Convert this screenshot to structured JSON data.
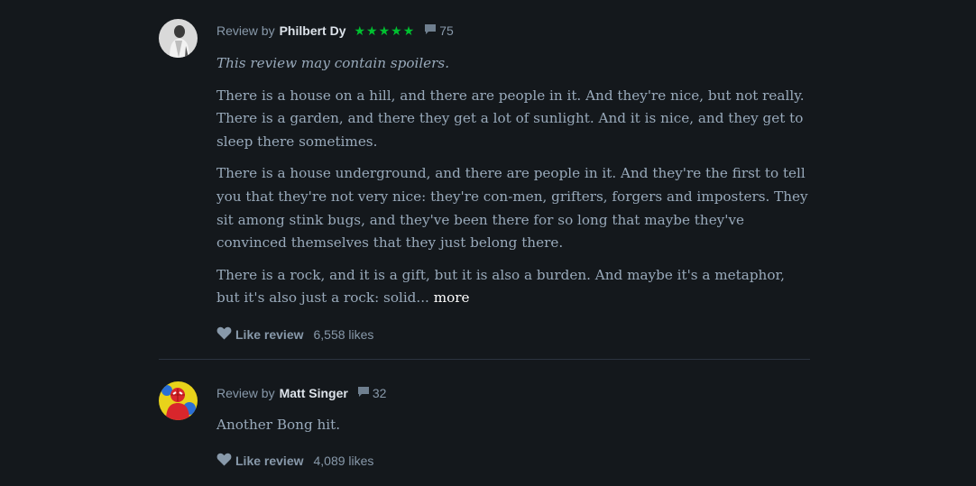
{
  "reviews": [
    {
      "review_by_label": "Review by",
      "author": "Philbert Dy",
      "stars": "★★★★★",
      "comment_count": "75",
      "spoiler_notice": "This review may contain spoilers.",
      "paragraphs": [
        "There is a house on a hill, and there are people in it. And they're nice, but not really. There is a garden, and there they get a lot of sunlight. And it is nice, and they get to sleep there sometimes.",
        "There is a house underground, and there are people in it. And they're the first to tell you that they're not very nice: they're con-men, grifters, forgers and imposters. They sit among stink bugs, and they've been there for so long that maybe they've convinced themselves that they just belong there.",
        "There is a rock, and it is a gift, but it is also a burden. And maybe it's a metaphor, but it's also just a rock: solid..."
      ],
      "more_label": "more",
      "like_label": "Like review",
      "likes": "6,558 likes"
    },
    {
      "review_by_label": "Review by",
      "author": "Matt Singer",
      "comment_count": "32",
      "paragraphs": [
        "Another Bong hit."
      ],
      "like_label": "Like review",
      "likes": "4,089 likes"
    }
  ],
  "colors": {
    "background": "#14181c",
    "text": "#99aabb",
    "author": "#dde3ea",
    "stars": "#00c030",
    "divider": "#2c3440"
  },
  "icons": {
    "comment": "speech-bubble-icon",
    "like": "heart-icon"
  }
}
